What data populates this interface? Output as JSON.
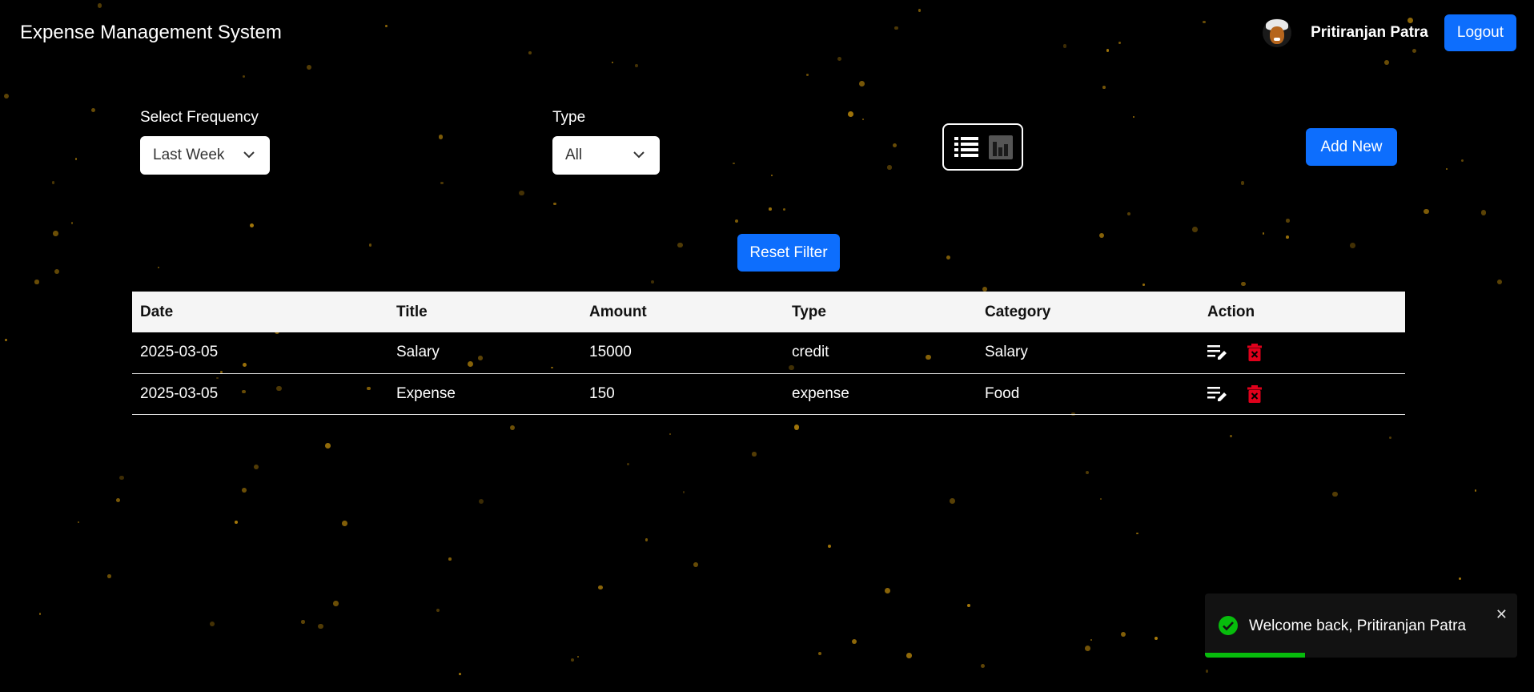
{
  "header": {
    "app_title": "Expense Management System",
    "user_name": "Pritiranjan Patra",
    "logout_label": "Logout"
  },
  "filters": {
    "frequency_label": "Select Frequency",
    "frequency_value": "Last Week",
    "type_label": "Type",
    "type_value": "All",
    "add_new_label": "Add New",
    "reset_label": "Reset Filter",
    "active_view": "list-icon"
  },
  "table": {
    "headers": [
      "Date",
      "Title",
      "Amount",
      "Type",
      "Category",
      "Action"
    ],
    "rows": [
      [
        "2025-03-05",
        "Salary",
        "15000",
        "credit",
        "Salary"
      ],
      [
        "2025-03-05",
        "Expense",
        "150",
        "expense",
        "Food"
      ]
    ]
  },
  "toast": {
    "message": "Welcome back, Pritiranjan Patra",
    "close_symbol": "✕",
    "progress": 0.32,
    "color": "#07bc0c"
  },
  "colors": {
    "accent": "#0d6efd",
    "delete": "#e0001b",
    "background": "#000000",
    "star": "#b8860b"
  }
}
